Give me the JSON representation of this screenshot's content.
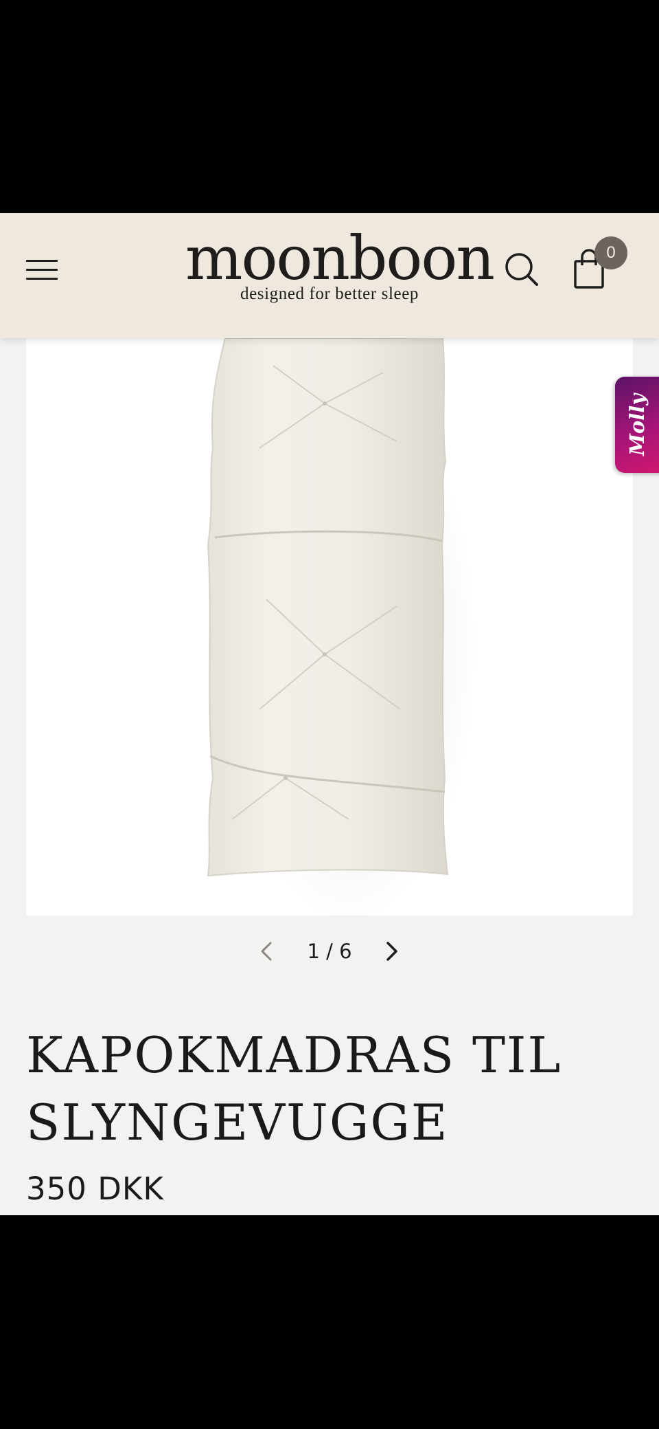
{
  "header": {
    "brand_name": "moonboon",
    "tagline": "designed for better sleep",
    "cart_count": "0",
    "background": "#efe8df"
  },
  "widget": {
    "label": "Molly",
    "gradient": [
      "#5c1466",
      "#d4186e"
    ]
  },
  "gallery": {
    "current": "1",
    "separator": "/",
    "total": "6"
  },
  "product": {
    "title": "KAPOKMADRAS TIL SLYNGEVUGGE",
    "price": "350 DKK"
  },
  "icons": {
    "menu": "hamburger-icon",
    "search": "search-icon",
    "cart": "shopping-bag-icon",
    "prev": "chevron-left-icon",
    "next": "chevron-right-icon"
  }
}
